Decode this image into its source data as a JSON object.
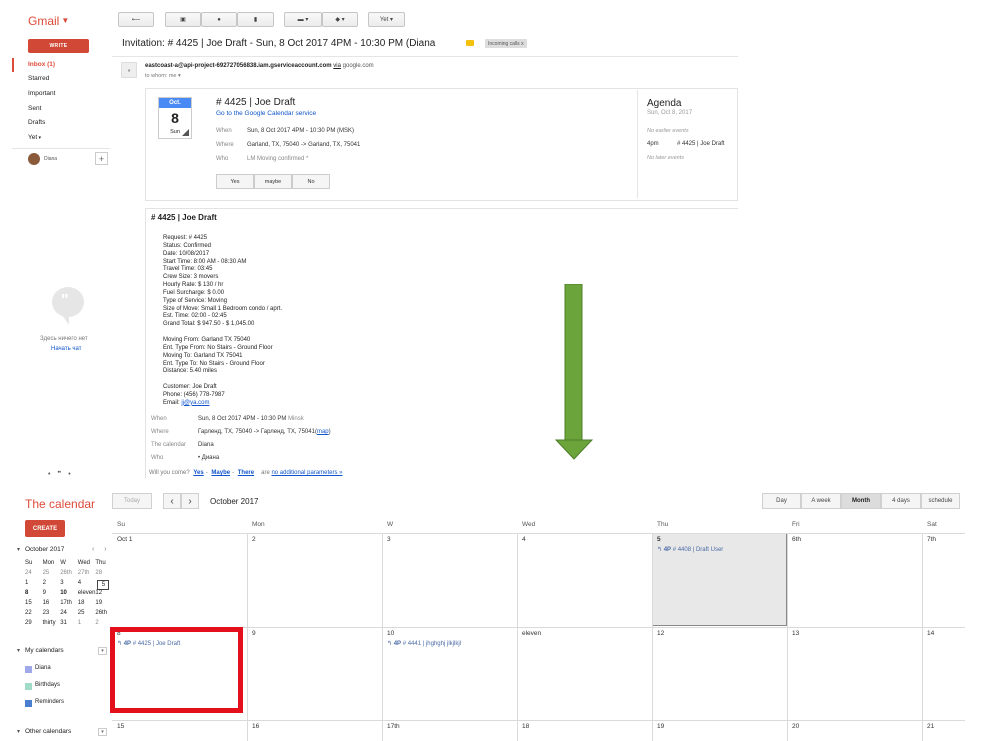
{
  "gmail": {
    "logo": "Gmail",
    "toolbar": {
      "back_icon": "reply-arrow-icon",
      "archive_icon": "archive-icon",
      "spam_icon": "report-icon",
      "delete_icon": "trash-icon",
      "move_icon": "folder-icon",
      "labels_icon": "label-icon",
      "more_label": "Yet"
    },
    "compose_label": "WRITE",
    "nav": [
      {
        "label": "Inbox (1)"
      },
      {
        "label": "Starred"
      },
      {
        "label": "Important"
      },
      {
        "label": "Sent"
      },
      {
        "label": "Drafts"
      },
      {
        "label": "Yet"
      }
    ],
    "chat": {
      "name": "Diana",
      "empty_text": "Здесь ничего нет",
      "start_link": "Начать чат"
    },
    "email": {
      "subject": "Invitation: # 4425 | Joe Draft - Sun, 8 Oct 2017 4PM - 10:30 PM (Diana",
      "label": "Incoming calls",
      "sender_address": "eastcoast-a@api-project-692727056838.iam.gserviceaccount.com",
      "via": "via",
      "via_domain": "google.com",
      "to_line": "to whom: me",
      "invite": {
        "month": "Oct.",
        "day": "8",
        "dow": "Sun",
        "title": "# 4425 | Joe Draft",
        "calendar_link": "Go to the Google Calendar service",
        "when_label": "When",
        "when_value": "Sun, 8 Oct 2017 4PM - 10:30 PM (MSK)",
        "where_label": "Where",
        "where_value": "Garland, TX, 75040 -> Garland, TX, 75041",
        "who_label": "Who",
        "who_value": "LM Moving confirmed *",
        "rsvp_yes": "Yes",
        "rsvp_maybe": "maybe",
        "rsvp_no": "No"
      },
      "agenda": {
        "title": "Agenda",
        "date": "Sun, Oct 8, 2017",
        "no_earlier": "No earlier events",
        "time": "4pm",
        "event": "# 4425 | Joe Draft",
        "no_later": "No later events"
      },
      "body": {
        "title": "# 4425 | Joe Draft",
        "lines": [
          "Request: # 4425",
          "Status: Confirmed",
          "Date: 10/08/2017",
          "Start Time: 8:00 AM - 08:30 AM",
          "Travel Time: 03:45",
          "Crew Size: 3 movers",
          "Hourly Rate: $ 130 / hr",
          "Fuel Surcharge: $ 0.00",
          "Type of Service: Moving",
          "Size of Move: Small 1 Bedroom condo / aprt.",
          "Est. Time: 02:00 - 02:45",
          "Grand Total: $ 947.50 - $ 1,045.00",
          "",
          "Moving From: Garland TX 75040",
          "Ent. Type From: No Stairs - Ground Floor",
          "Moving To: Garland TX 75041",
          "Ent. Type To: No Stairs - Ground Floor",
          "Distance: 5.40 miles",
          "",
          "Customer: Joe Draft",
          "Phone: (456) 778-7987"
        ],
        "email_label": "Email:",
        "email_value": "jj@ya.com",
        "when_label": "When",
        "when_value": "Sun, 8 Oct 2017 4PM - 10:30 PM",
        "when_tz": "Minsk",
        "where_label": "Where",
        "where_value": "Гарленд, TX, 75040 -> Гарленд, TX, 75041(",
        "map_link": "map",
        "where_close": ")",
        "calendar_label": "The calendar",
        "calendar_value": "Diana",
        "who_label": "Who",
        "who_value": "•  Диана",
        "will_you_come": "Will you come?",
        "yes": "Yes",
        "maybe": "Maybe",
        "there": "There",
        "are": "are",
        "no_params": "no additional parameters »"
      }
    }
  },
  "calendar": {
    "logo": "The calendar",
    "create_label": "CREATE",
    "today_label": "Today",
    "prev_icon": "‹",
    "next_icon": "›",
    "month_label": "October 2017",
    "views": [
      "Day",
      "A week",
      "Month",
      "4 days",
      "schedule"
    ],
    "active_view": "Month",
    "mini": {
      "title": "October 2017",
      "nav": "‹ ›",
      "header": [
        "Su",
        "Mon",
        "W",
        "Wed",
        "Thu"
      ],
      "rows": [
        [
          "24",
          "25",
          "26th",
          "27th",
          "28"
        ],
        [
          "1",
          "2",
          "3",
          "4",
          "5"
        ],
        [
          "8",
          "9",
          "10",
          "eleven",
          "12"
        ],
        [
          "15",
          "16",
          "17th",
          "18",
          "19"
        ],
        [
          "22",
          "23",
          "24",
          "25",
          "26th"
        ],
        [
          "29",
          "thirty",
          "31",
          "1",
          "2"
        ]
      ]
    },
    "my_calendars_title": "My calendars",
    "my_calendars": [
      {
        "name": "Diana",
        "color": "#9fa8e8"
      },
      {
        "name": "Birthdays",
        "color": "#a0dcc8"
      },
      {
        "name": "Reminders",
        "color": "#4a7fd0"
      }
    ],
    "other_calendars_title": "Other calendars",
    "weekdays": [
      "Su",
      "Mon",
      "W",
      "Wed",
      "Thu",
      "Fri",
      "Sat"
    ],
    "weeks": [
      [
        "Oct 1",
        "2",
        "3",
        "4",
        "5",
        "6th",
        "7th"
      ],
      [
        "8",
        "9",
        "10",
        "eleven",
        "12",
        "13",
        "14"
      ],
      [
        "15",
        "16",
        "17th",
        "18",
        "19",
        "20",
        "21"
      ]
    ],
    "events": [
      {
        "time": "4P",
        "title": "# 4408 | Draft User"
      },
      {
        "time": "4P",
        "title": "# 4425 | Joe Draft"
      },
      {
        "time": "4P",
        "title": "# 4441 | jhghghj jlkjlkjl"
      }
    ],
    "colors": {
      "accent": "#dd4b39",
      "highlight": "#e3101b",
      "arrow": "#6aa43a"
    }
  }
}
